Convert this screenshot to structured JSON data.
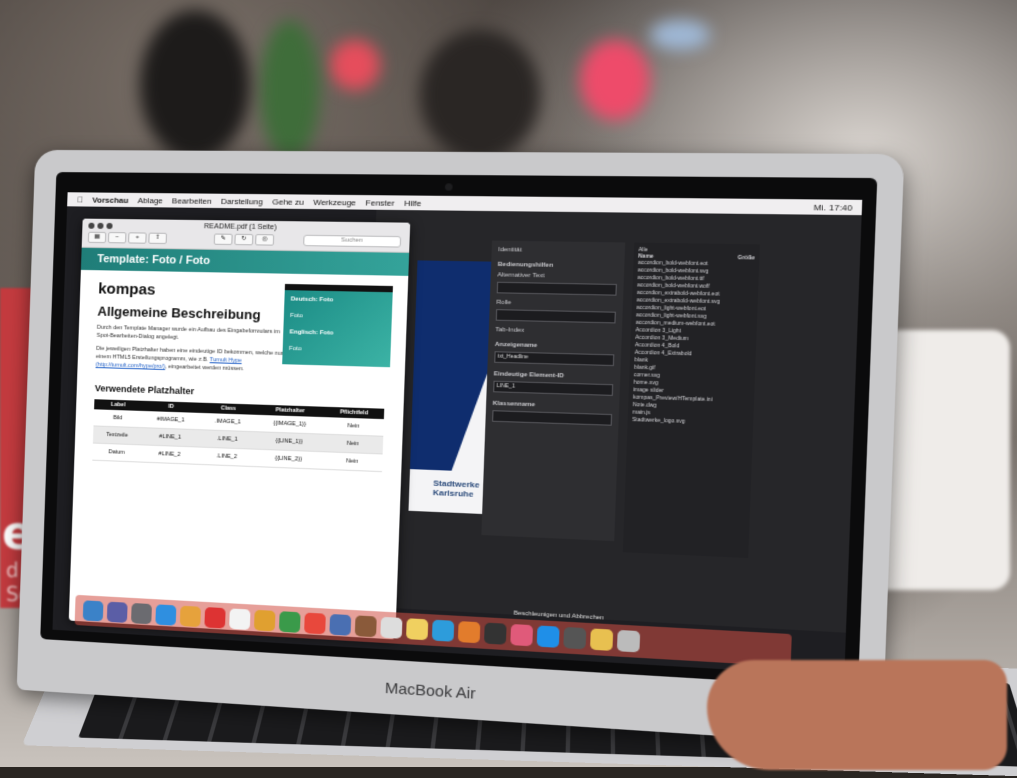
{
  "mac_menubar": {
    "items": [
      "Vorschau",
      "Ablage",
      "Bearbeiten",
      "Darstellung",
      "Gehe zu",
      "Werkzeuge",
      "Fenster",
      "Hilfe"
    ],
    "status": "Mi. 17:40"
  },
  "preview_window": {
    "title": "README.pdf (1 Seite)",
    "search_placeholder": "Suchen",
    "banner": "Template: Foto / Foto",
    "logo": "kompas",
    "heading": "Allgemeine Beschreibung",
    "intro": "Durch den Template Manager wurde ein Aufbau des Eingabeformulars im Spot-Bearbeiten-Dialog angelegt.",
    "para2_prefix": "Die jeweiligen Platzhalter haben eine eindeutige ID bekommen, welche nun in einem HTML5 Erstellungsprogramm, wie z.B.",
    "para2_link": "Tumult Hype (http://tumult.com/hype/pro/)",
    "para2_suffix": ", eingearbeitet werden müssen.",
    "thumbnail": {
      "line1": "Deutsch: Foto",
      "line2": "Foto",
      "line3": "Englisch: Foto",
      "line4": "Foto"
    },
    "section_heading": "Verwendete Platzhalter",
    "table": {
      "headers": [
        "Label",
        "ID",
        "Class",
        "Platzhalter",
        "Pflichtfeld"
      ],
      "rows": [
        [
          "Bild",
          "#IMAGE_1",
          ".IMAGE_1",
          "{{IMAGE_1}}",
          "Nein"
        ],
        [
          "Textzeile",
          "#LINE_1",
          ".LINE_1",
          "{{LINE_1}}",
          "Nein"
        ],
        [
          "Datum",
          "#LINE_2",
          ".LINE_2",
          "{{LINE_2}}",
          "Nein"
        ]
      ]
    }
  },
  "dark_app": {
    "logo_text_1": "Stadtwerke",
    "logo_text_2": "Karlsruhe",
    "inspector": {
      "title": "Identität",
      "section1": "Bedienungshilfen",
      "field1": "Alternativer Text",
      "field2": "Rolle",
      "checkbox": "Tab-Index",
      "label_anzeigename": "Anzeigename",
      "value_anzeigename": "txt_Headline",
      "label_element_id": "Eindeutige Element-ID",
      "value_element_id": "LINE_1",
      "label_klassenname": "Klassenname"
    },
    "files_title": "Alle",
    "files_header_name": "Name",
    "files_header_size": "Größe",
    "files": [
      "accordion_bold-webfont.eot",
      "accordion_bold-webfont.svg",
      "accordion_bold-webfont.ttf",
      "accordion_bold-webfont.woff",
      "accordion_extrabold-webfont.eot",
      "accordion_extrabold-webfont.svg",
      "accordion_light-webfont.eot",
      "accordion_light-webfont.svg",
      "accordion_medium-webfont.eot",
      "Accordion 3_Light",
      "Accordion 3_Medium",
      "Accordion 4_Bold",
      "Accordion 4_Extrabold",
      "blank",
      "blank.gif",
      "corner.svg",
      "home.svg",
      "image slider",
      "kompas_Preview/HTemplate.ini",
      "Note.dwg",
      "main.js",
      "Stadtwerke_logo.svg"
    ],
    "footer_button": "Beschleunigen und Abbrechen"
  },
  "laptop_brand": "MacBook Air",
  "background_sign": {
    "word_1": "edi",
    "word_2": "d Serv"
  }
}
